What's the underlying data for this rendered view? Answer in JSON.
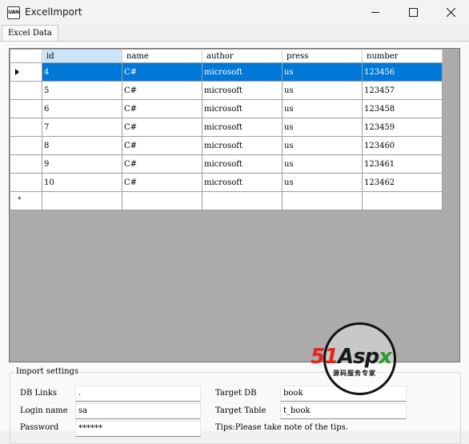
{
  "window": {
    "icon_text": "UAN",
    "title": "ExcelImport"
  },
  "tabs": [
    {
      "label": "Excel Data",
      "active": true
    }
  ],
  "grid": {
    "columns": [
      "id",
      "name",
      "author",
      "press",
      "number"
    ],
    "sorted_column": "id",
    "rows": [
      {
        "id": "4",
        "name": "C#",
        "author": "microsoft",
        "press": "us",
        "number": "123456",
        "selected": true
      },
      {
        "id": "5",
        "name": "C#",
        "author": "microsoft",
        "press": "us",
        "number": "123457"
      },
      {
        "id": "6",
        "name": "C#",
        "author": "microsoft",
        "press": "us",
        "number": "123458"
      },
      {
        "id": "7",
        "name": "C#",
        "author": "microsoft",
        "press": "us",
        "number": "123459"
      },
      {
        "id": "8",
        "name": "C#",
        "author": "microsoft",
        "press": "us",
        "number": "123460"
      },
      {
        "id": "9",
        "name": "C#",
        "author": "microsoft",
        "press": "us",
        "number": "123461"
      },
      {
        "id": "10",
        "name": "C#",
        "author": "microsoft",
        "press": "us",
        "number": "123462"
      }
    ],
    "new_row_marker": "*",
    "selection_color": "#0078d7"
  },
  "settings": {
    "legend": "Import settings",
    "db_links_label": "DB Links",
    "db_links_value": ".",
    "login_name_label": "Login name",
    "login_name_value": "sa",
    "password_label": "Password",
    "password_value": "******",
    "target_db_label": "Target DB",
    "target_db_value": "book",
    "target_table_label": "Target Table",
    "target_table_value": "t_book",
    "tips_text": "Tips:Please take note of the tips."
  },
  "watermark": {
    "brand_red": "51",
    "brand_black": "Asp",
    "brand_green": "x",
    "subtitle": "源码服务专家"
  },
  "icons": [
    "app-icon",
    "minimize-icon",
    "maximize-icon",
    "close-icon",
    "row-pointer-icon",
    "new-row-icon"
  ]
}
